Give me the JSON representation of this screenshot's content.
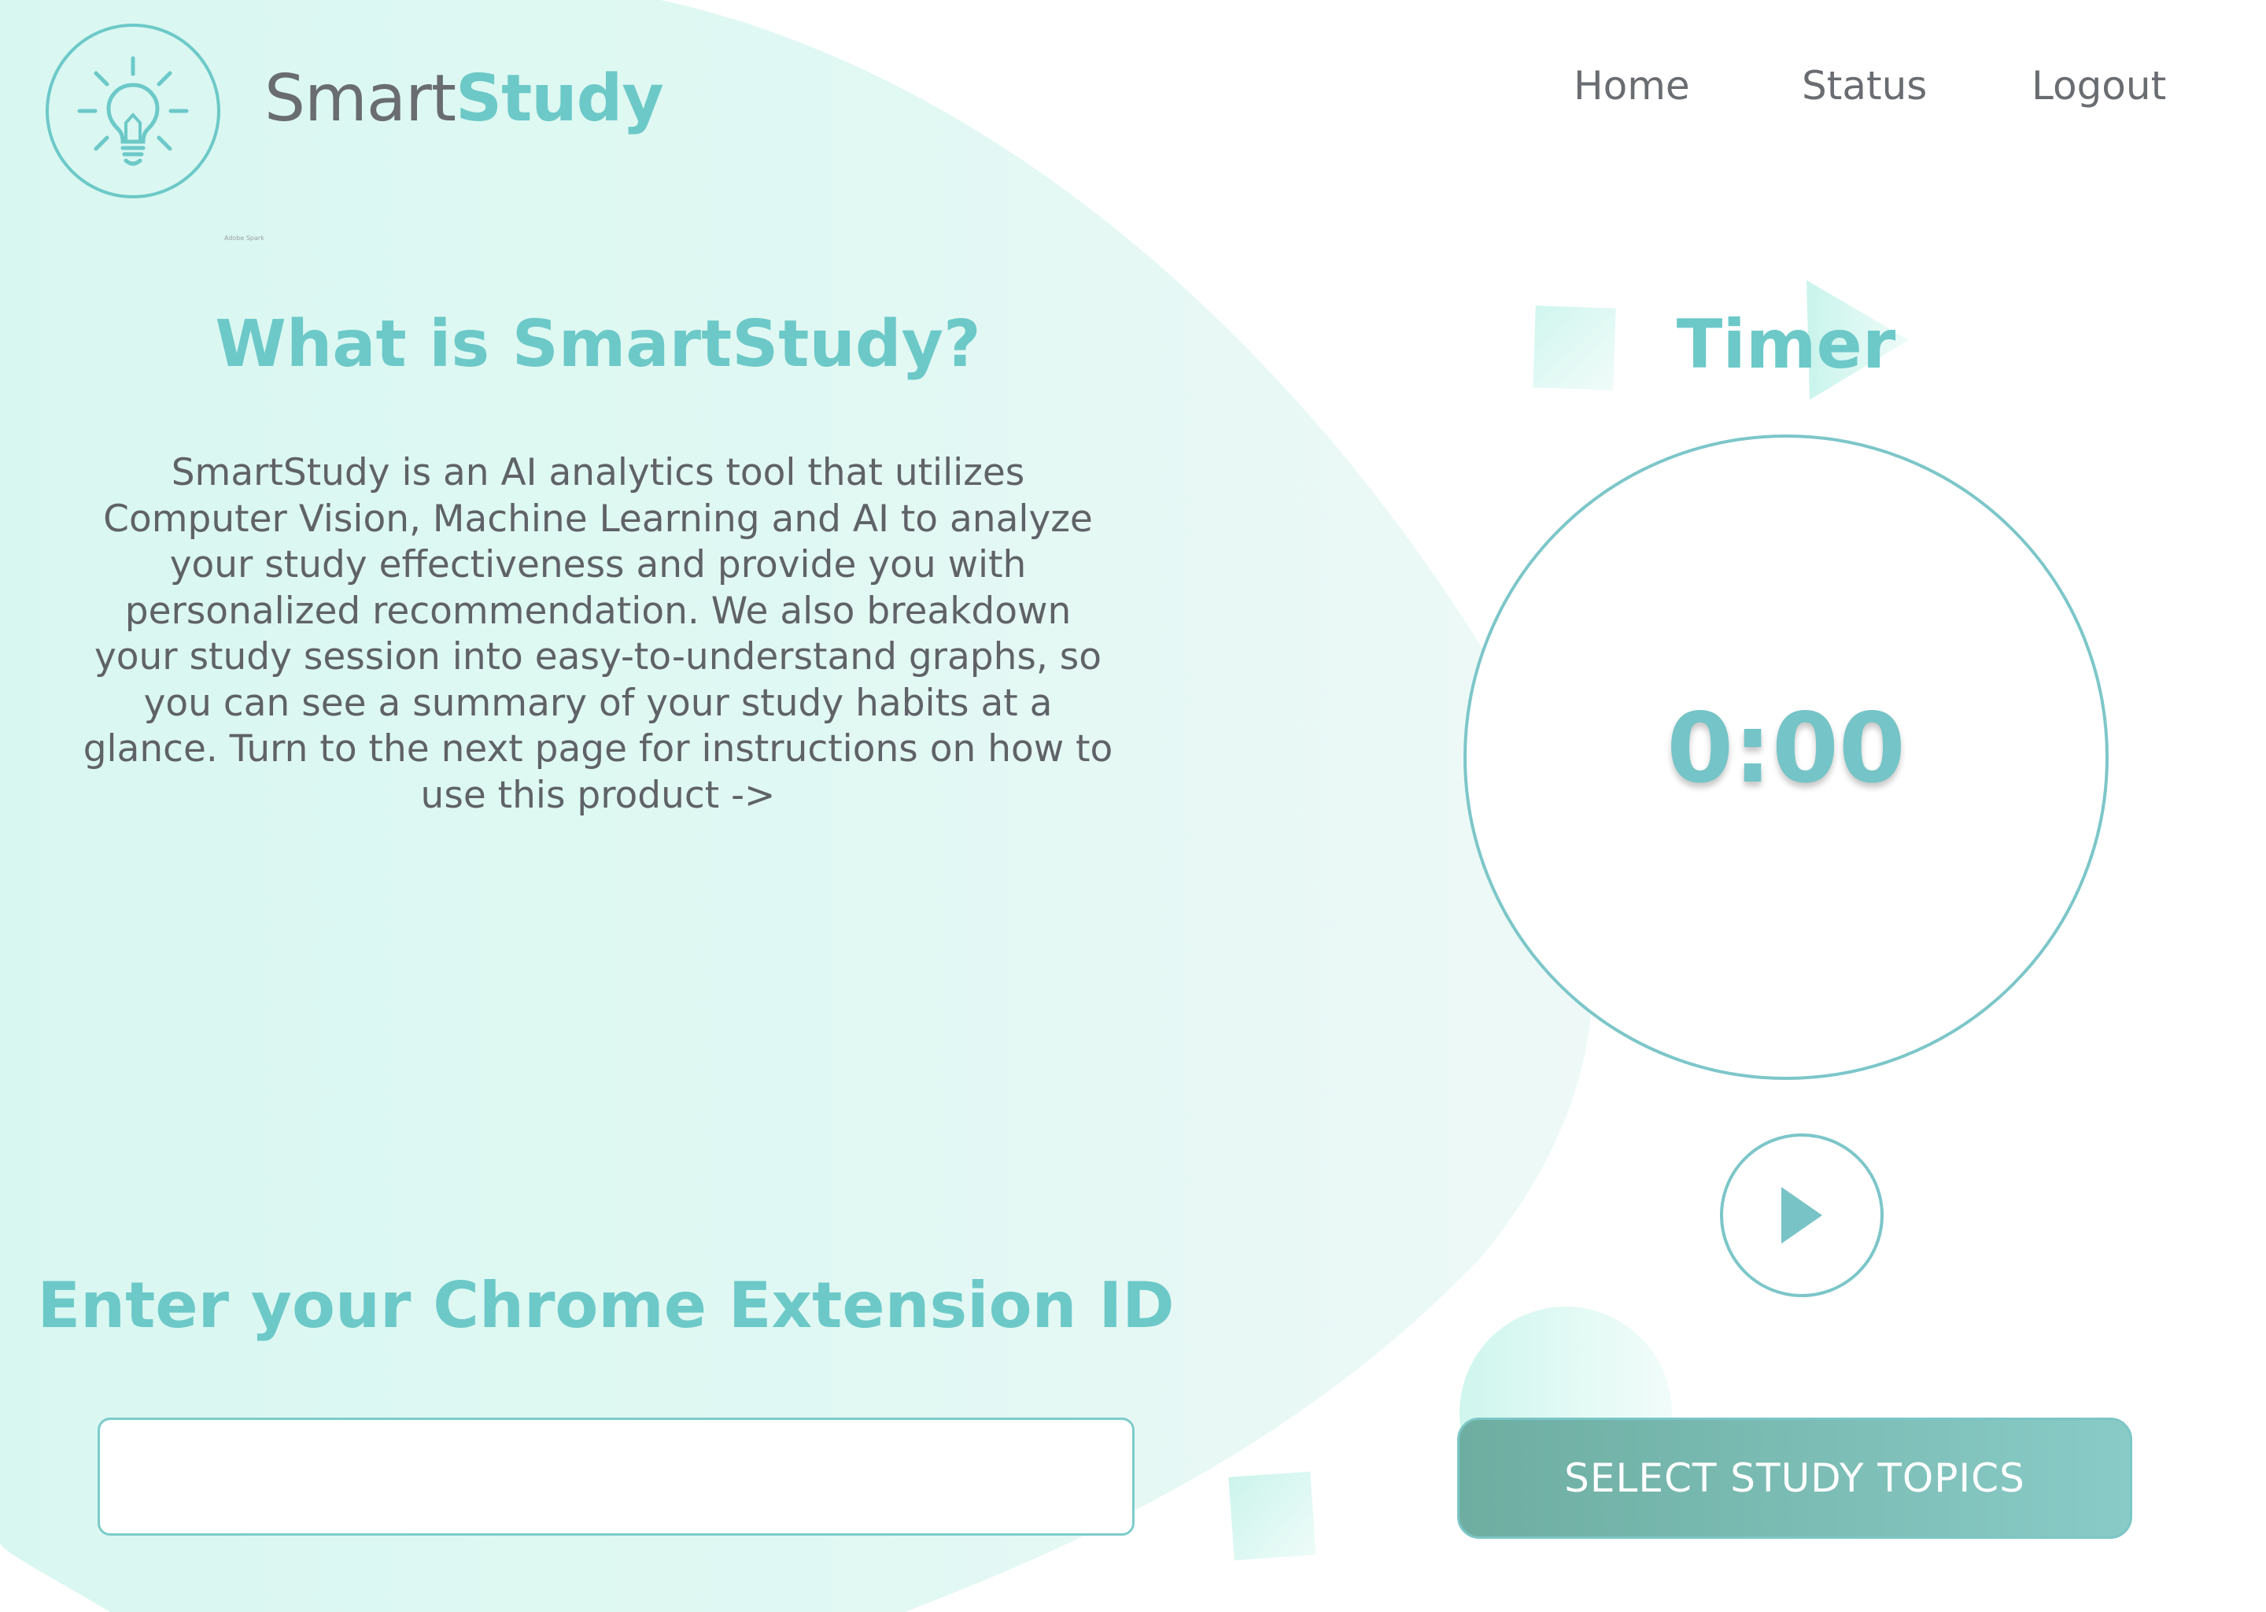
{
  "header": {
    "brand_part1": "Smart",
    "brand_part2": "Study",
    "tiny_badge": "Adobe Spark",
    "nav": [
      {
        "label": "Home"
      },
      {
        "label": "Status"
      },
      {
        "label": "Logout"
      }
    ]
  },
  "about": {
    "title": "What is SmartStudy?",
    "description": "SmartStudy is an AI analytics tool that utilizes Computer Vision, Machine Learning and AI to analyze your study effectiveness and provide you with personalized recommendation. We also breakdown your study session into easy-to-understand graphs, so you can see a summary of your study habits at a glance. Turn to the next page for instructions on how to use this product ->"
  },
  "extension": {
    "title": "Enter your Chrome Extension ID",
    "input_value": "",
    "input_placeholder": ""
  },
  "timer": {
    "title": "Timer",
    "value": "0:00",
    "play_icon": "play-icon",
    "select_label": "SELECT STUDY TOPICS"
  },
  "icons": {
    "logo": "lightbulb-icon"
  },
  "colors": {
    "accent": "#6cc9c8",
    "text": "#5f6266",
    "blob": "#dcf8f2",
    "button": "#78b9b0"
  }
}
